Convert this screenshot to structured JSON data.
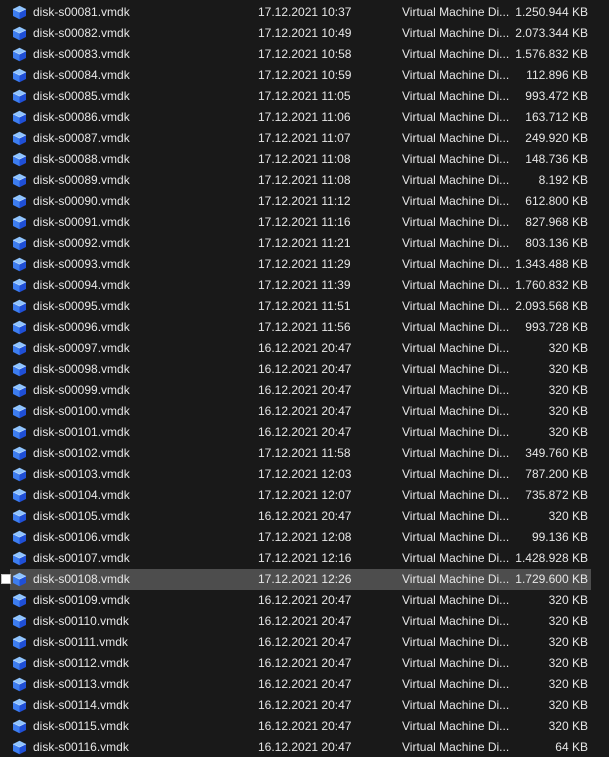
{
  "rows": [
    {
      "name": "disk-s00081.vmdk",
      "date": "17.12.2021 10:37",
      "type": "Virtual Machine Di...",
      "size": "1.250.944 KB"
    },
    {
      "name": "disk-s00082.vmdk",
      "date": "17.12.2021 10:49",
      "type": "Virtual Machine Di...",
      "size": "2.073.344 KB"
    },
    {
      "name": "disk-s00083.vmdk",
      "date": "17.12.2021 10:58",
      "type": "Virtual Machine Di...",
      "size": "1.576.832 KB"
    },
    {
      "name": "disk-s00084.vmdk",
      "date": "17.12.2021 10:59",
      "type": "Virtual Machine Di...",
      "size": "112.896 KB"
    },
    {
      "name": "disk-s00085.vmdk",
      "date": "17.12.2021 11:05",
      "type": "Virtual Machine Di...",
      "size": "993.472 KB"
    },
    {
      "name": "disk-s00086.vmdk",
      "date": "17.12.2021 11:06",
      "type": "Virtual Machine Di...",
      "size": "163.712 KB"
    },
    {
      "name": "disk-s00087.vmdk",
      "date": "17.12.2021 11:07",
      "type": "Virtual Machine Di...",
      "size": "249.920 KB"
    },
    {
      "name": "disk-s00088.vmdk",
      "date": "17.12.2021 11:08",
      "type": "Virtual Machine Di...",
      "size": "148.736 KB"
    },
    {
      "name": "disk-s00089.vmdk",
      "date": "17.12.2021 11:08",
      "type": "Virtual Machine Di...",
      "size": "8.192 KB"
    },
    {
      "name": "disk-s00090.vmdk",
      "date": "17.12.2021 11:12",
      "type": "Virtual Machine Di...",
      "size": "612.800 KB"
    },
    {
      "name": "disk-s00091.vmdk",
      "date": "17.12.2021 11:16",
      "type": "Virtual Machine Di...",
      "size": "827.968 KB"
    },
    {
      "name": "disk-s00092.vmdk",
      "date": "17.12.2021 11:21",
      "type": "Virtual Machine Di...",
      "size": "803.136 KB"
    },
    {
      "name": "disk-s00093.vmdk",
      "date": "17.12.2021 11:29",
      "type": "Virtual Machine Di...",
      "size": "1.343.488 KB"
    },
    {
      "name": "disk-s00094.vmdk",
      "date": "17.12.2021 11:39",
      "type": "Virtual Machine Di...",
      "size": "1.760.832 KB"
    },
    {
      "name": "disk-s00095.vmdk",
      "date": "17.12.2021 11:51",
      "type": "Virtual Machine Di...",
      "size": "2.093.568 KB"
    },
    {
      "name": "disk-s00096.vmdk",
      "date": "17.12.2021 11:56",
      "type": "Virtual Machine Di...",
      "size": "993.728 KB"
    },
    {
      "name": "disk-s00097.vmdk",
      "date": "16.12.2021 20:47",
      "type": "Virtual Machine Di...",
      "size": "320 KB"
    },
    {
      "name": "disk-s00098.vmdk",
      "date": "16.12.2021 20:47",
      "type": "Virtual Machine Di...",
      "size": "320 KB"
    },
    {
      "name": "disk-s00099.vmdk",
      "date": "16.12.2021 20:47",
      "type": "Virtual Machine Di...",
      "size": "320 KB"
    },
    {
      "name": "disk-s00100.vmdk",
      "date": "16.12.2021 20:47",
      "type": "Virtual Machine Di...",
      "size": "320 KB"
    },
    {
      "name": "disk-s00101.vmdk",
      "date": "16.12.2021 20:47",
      "type": "Virtual Machine Di...",
      "size": "320 KB"
    },
    {
      "name": "disk-s00102.vmdk",
      "date": "17.12.2021 11:58",
      "type": "Virtual Machine Di...",
      "size": "349.760 KB"
    },
    {
      "name": "disk-s00103.vmdk",
      "date": "17.12.2021 12:03",
      "type": "Virtual Machine Di...",
      "size": "787.200 KB"
    },
    {
      "name": "disk-s00104.vmdk",
      "date": "17.12.2021 12:07",
      "type": "Virtual Machine Di...",
      "size": "735.872 KB"
    },
    {
      "name": "disk-s00105.vmdk",
      "date": "16.12.2021 20:47",
      "type": "Virtual Machine Di...",
      "size": "320 KB"
    },
    {
      "name": "disk-s00106.vmdk",
      "date": "17.12.2021 12:08",
      "type": "Virtual Machine Di...",
      "size": "99.136 KB"
    },
    {
      "name": "disk-s00107.vmdk",
      "date": "17.12.2021 12:16",
      "type": "Virtual Machine Di...",
      "size": "1.428.928 KB"
    },
    {
      "name": "disk-s00108.vmdk",
      "date": "17.12.2021 12:26",
      "type": "Virtual Machine Di...",
      "size": "1.729.600 KB",
      "selected": true
    },
    {
      "name": "disk-s00109.vmdk",
      "date": "16.12.2021 20:47",
      "type": "Virtual Machine Di...",
      "size": "320 KB"
    },
    {
      "name": "disk-s00110.vmdk",
      "date": "16.12.2021 20:47",
      "type": "Virtual Machine Di...",
      "size": "320 KB"
    },
    {
      "name": "disk-s00111.vmdk",
      "date": "16.12.2021 20:47",
      "type": "Virtual Machine Di...",
      "size": "320 KB"
    },
    {
      "name": "disk-s00112.vmdk",
      "date": "16.12.2021 20:47",
      "type": "Virtual Machine Di...",
      "size": "320 KB"
    },
    {
      "name": "disk-s00113.vmdk",
      "date": "16.12.2021 20:47",
      "type": "Virtual Machine Di...",
      "size": "320 KB"
    },
    {
      "name": "disk-s00114.vmdk",
      "date": "16.12.2021 20:47",
      "type": "Virtual Machine Di...",
      "size": "320 KB"
    },
    {
      "name": "disk-s00115.vmdk",
      "date": "16.12.2021 20:47",
      "type": "Virtual Machine Di...",
      "size": "320 KB"
    },
    {
      "name": "disk-s00116.vmdk",
      "date": "16.12.2021 20:47",
      "type": "Virtual Machine Di...",
      "size": "64 KB"
    }
  ],
  "icon": "vmdk-cube-icon",
  "colors": {
    "background": "#191919",
    "selected_row": "#4d4d4d",
    "text": "#e6e6e6",
    "icon_light": "#5fa8ff",
    "icon_dark": "#1f4fd6"
  }
}
